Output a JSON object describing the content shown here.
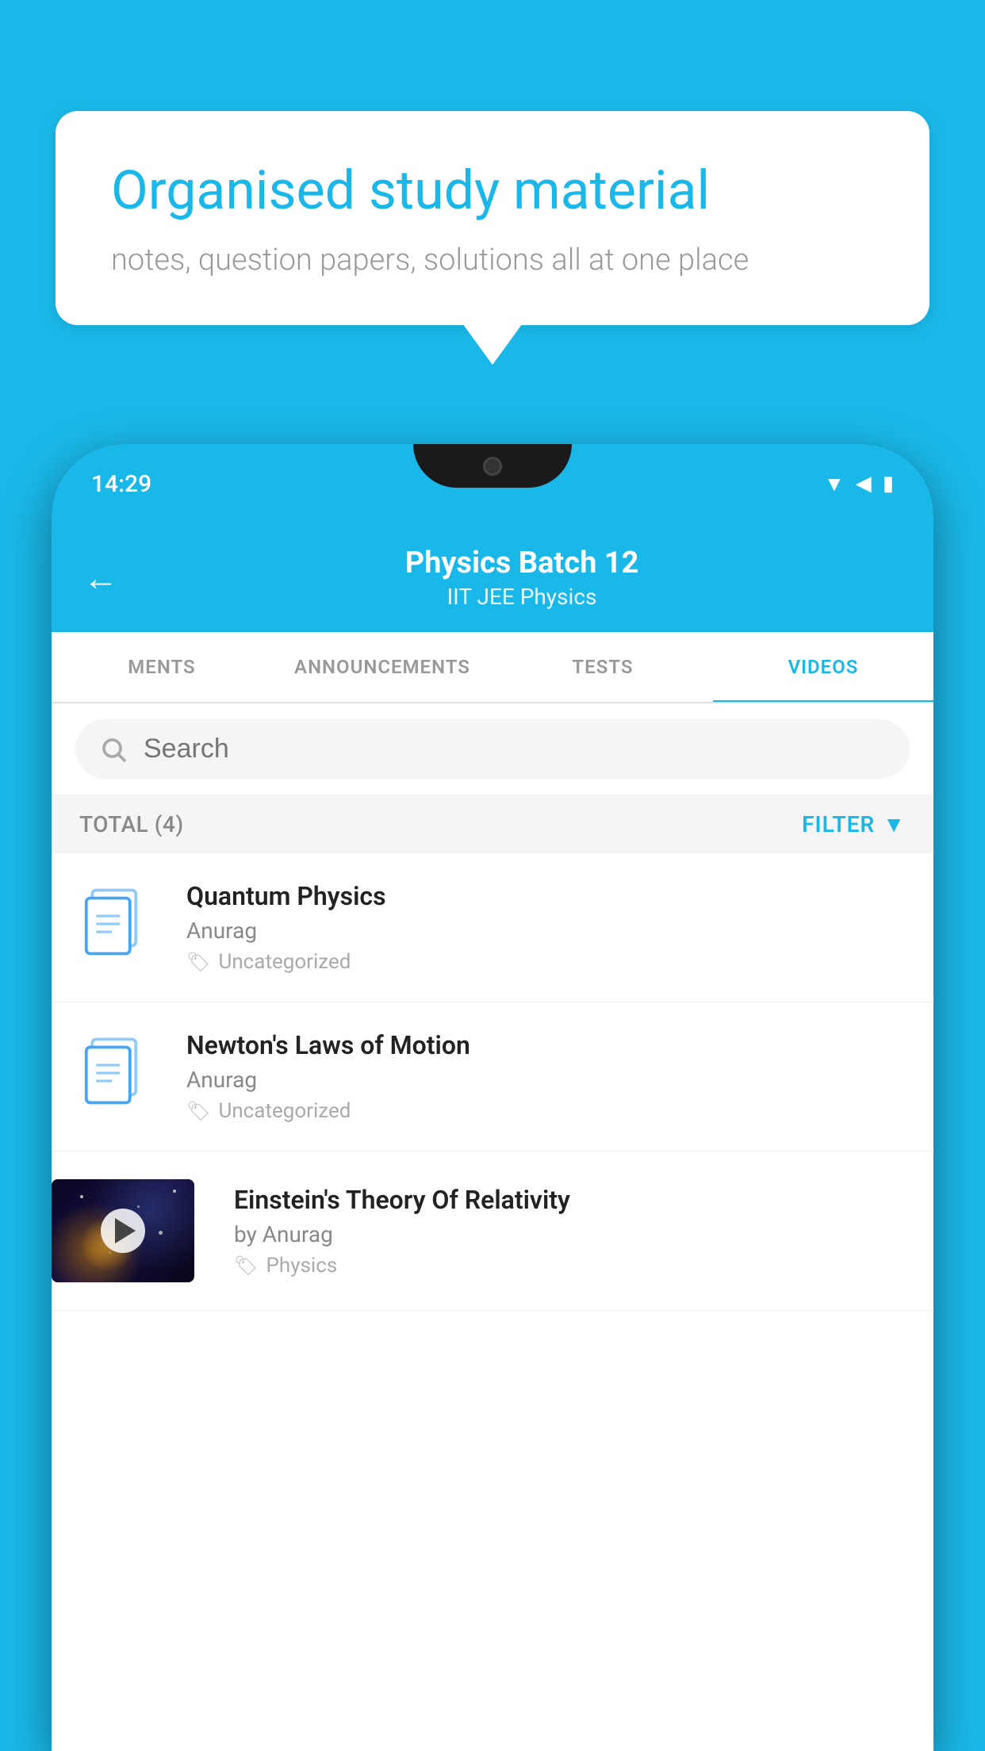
{
  "bubble": {
    "title": "Organised study material",
    "subtitle": "notes, question papers, solutions all at one place"
  },
  "phone": {
    "status_time": "14:29",
    "header": {
      "title": "Physics Batch 12",
      "subtitle": "IIT JEE   Physics",
      "back_label": "←"
    },
    "tabs": [
      {
        "label": "MENTS",
        "active": false
      },
      {
        "label": "ANNOUNCEMENTS",
        "active": false
      },
      {
        "label": "TESTS",
        "active": false
      },
      {
        "label": "VIDEOS",
        "active": true
      }
    ],
    "search": {
      "placeholder": "Search"
    },
    "total_label": "TOTAL (4)",
    "filter_label": "FILTER",
    "videos": [
      {
        "title": "Quantum Physics",
        "author": "Anurag",
        "tag": "Uncategorized",
        "has_thumb": false
      },
      {
        "title": "Newton's Laws of Motion",
        "author": "Anurag",
        "tag": "Uncategorized",
        "has_thumb": false
      },
      {
        "title": "Einstein's Theory Of Relativity",
        "author": "by Anurag",
        "tag": "Physics",
        "has_thumb": true
      }
    ]
  }
}
